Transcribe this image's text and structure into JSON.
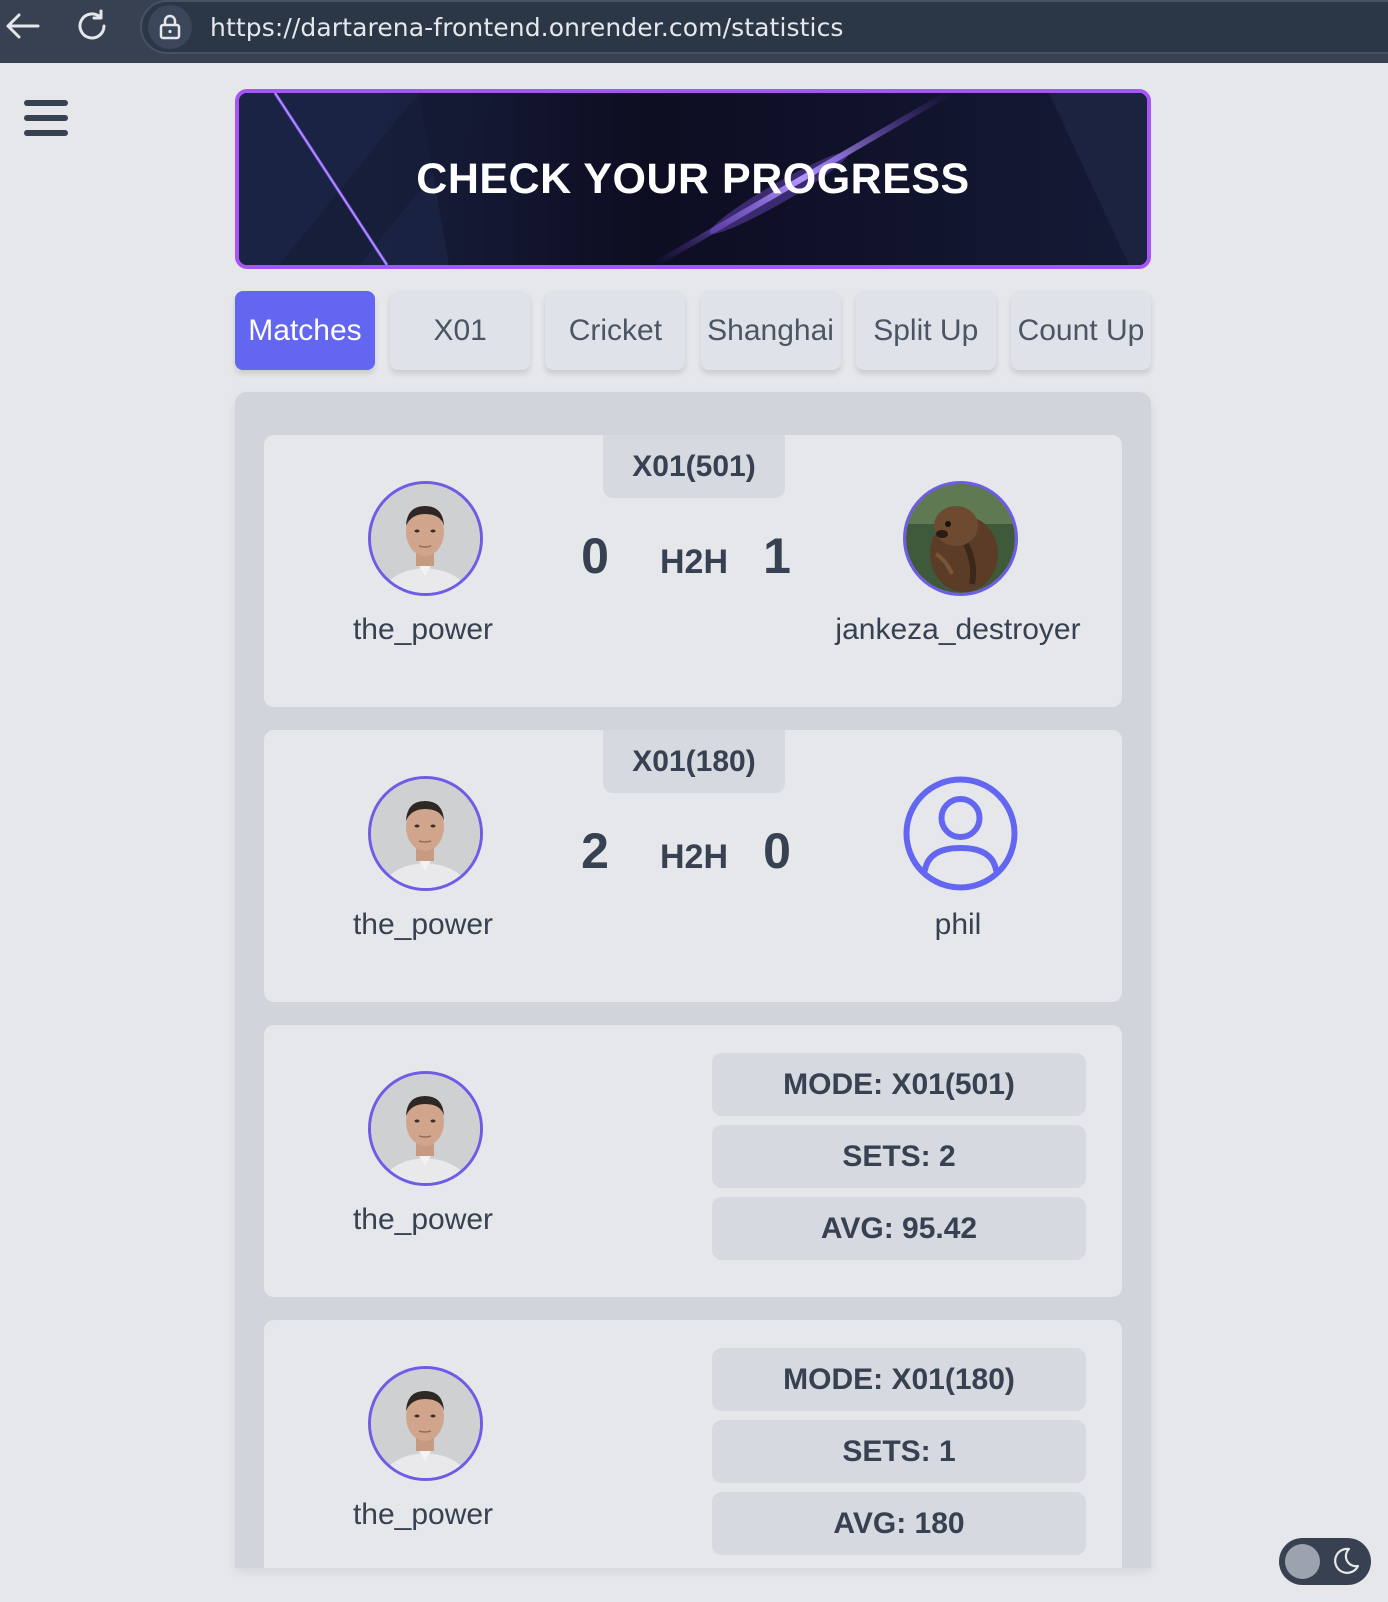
{
  "browser": {
    "url": "https://dartarena-frontend.onrender.com/statistics"
  },
  "banner": {
    "title": "CHECK YOUR PROGRESS"
  },
  "tabs": [
    {
      "label": "Matches",
      "active": true
    },
    {
      "label": "X01",
      "active": false
    },
    {
      "label": "Cricket",
      "active": false
    },
    {
      "label": "Shanghai",
      "active": false
    },
    {
      "label": "Split Up",
      "active": false
    },
    {
      "label": "Count Up",
      "active": false
    }
  ],
  "matches": [
    {
      "mode": "X01(501)",
      "player1": {
        "name": "the_power",
        "score": "0",
        "avatar": "photo"
      },
      "separator": "H2H",
      "player2": {
        "name": "jankeza_destroyer",
        "score": "1",
        "avatar": "beaver-photo"
      }
    },
    {
      "mode": "X01(180)",
      "player1": {
        "name": "the_power",
        "score": "2",
        "avatar": "photo"
      },
      "separator": "H2H",
      "player2": {
        "name": "phil",
        "score": "0",
        "avatar": "user-icon"
      }
    }
  ],
  "solo_games": [
    {
      "player": "the_power",
      "mode": "MODE: X01(501)",
      "sets": "SETS: 2",
      "avg": "AVG: 95.42"
    },
    {
      "player": "the_power",
      "mode": "MODE: X01(180)",
      "sets": "SETS: 1",
      "avg": "AVG: 180"
    }
  ],
  "colors": {
    "accent": "#6366f1",
    "banner_border": "#a855f7",
    "avatar_border": "#6d5ce6"
  }
}
